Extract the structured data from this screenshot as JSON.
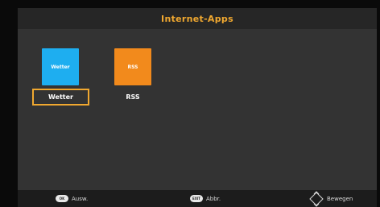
{
  "header": {
    "title": "Internet-Apps"
  },
  "apps": [
    {
      "tile_text": "Wetter",
      "label": "Wetter",
      "color": "#1eaef0",
      "selected": true
    },
    {
      "tile_text": "RSS",
      "label": "RSS",
      "color": "#f28a1c",
      "selected": false
    }
  ],
  "footer": {
    "hints": [
      {
        "key": "OK",
        "label": "Ausw."
      },
      {
        "key": "EXIT",
        "label": "Abbr."
      },
      {
        "key": "arrows-icon",
        "label": "Bewegen"
      }
    ]
  },
  "colors": {
    "accent": "#f0a830",
    "background": "#333333"
  }
}
